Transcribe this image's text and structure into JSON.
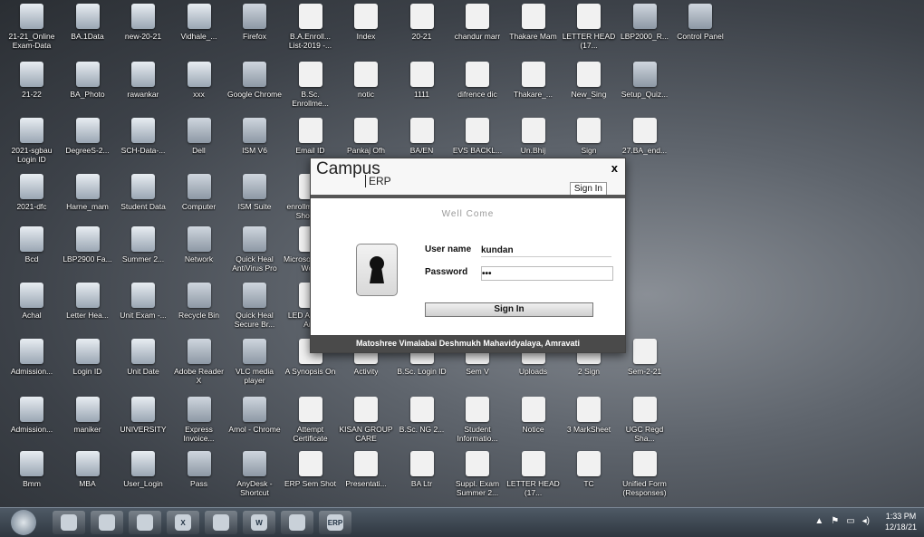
{
  "desktop": {
    "icons": [
      {
        "label": "21-21_Online Exam-Data",
        "kind": "folder"
      },
      {
        "label": "BA.1Data",
        "kind": "folder"
      },
      {
        "label": "new-20-21",
        "kind": "folder"
      },
      {
        "label": "Vidhale_...",
        "kind": "folder"
      },
      {
        "label": "Firefox",
        "kind": "app"
      },
      {
        "label": "B.A.Enroll... List-2019 -...",
        "kind": "doc"
      },
      {
        "label": "Index",
        "kind": "doc"
      },
      {
        "label": "20-21",
        "kind": "doc"
      },
      {
        "label": "chandur marr",
        "kind": "doc"
      },
      {
        "label": "Thakare Mam",
        "kind": "doc"
      },
      {
        "label": "LETTER HEAD (17...",
        "kind": "doc"
      },
      {
        "label": "LBP2000_R...",
        "kind": "app"
      },
      {
        "label": "Control Panel",
        "kind": "app"
      },
      {
        "label": "21-22",
        "kind": "folder"
      },
      {
        "label": "BA_Photo",
        "kind": "folder"
      },
      {
        "label": "rawankar",
        "kind": "folder"
      },
      {
        "label": "xxx",
        "kind": "folder"
      },
      {
        "label": "Google Chrome",
        "kind": "app"
      },
      {
        "label": "B.Sc. Enrollme...",
        "kind": "doc"
      },
      {
        "label": "notic",
        "kind": "doc"
      },
      {
        "label": "1111",
        "kind": "doc"
      },
      {
        "label": "difrence dic",
        "kind": "doc"
      },
      {
        "label": "Thakare_...",
        "kind": "doc"
      },
      {
        "label": "New_Sing",
        "kind": "doc"
      },
      {
        "label": "Setup_Quiz...",
        "kind": "app"
      },
      {
        "label": "2021-sgbau Login ID",
        "kind": "folder"
      },
      {
        "label": "DegreeS-2...",
        "kind": "folder"
      },
      {
        "label": "SCH-Data-...",
        "kind": "folder"
      },
      {
        "label": "Dell",
        "kind": "app"
      },
      {
        "label": "ISM V6",
        "kind": "app"
      },
      {
        "label": "Email ID",
        "kind": "doc"
      },
      {
        "label": "Pankaj Ofh",
        "kind": "doc"
      },
      {
        "label": "BA/EN",
        "kind": "doc"
      },
      {
        "label": "EVS BACKL...",
        "kind": "doc"
      },
      {
        "label": "Un.Bhij",
        "kind": "doc"
      },
      {
        "label": "Sign",
        "kind": "doc"
      },
      {
        "label": "27.BA_end...",
        "kind": "doc"
      },
      {
        "label": "2021-dfc",
        "kind": "folder"
      },
      {
        "label": "Harne_mam",
        "kind": "folder"
      },
      {
        "label": "Student Data",
        "kind": "folder"
      },
      {
        "label": "Computer",
        "kind": "app"
      },
      {
        "label": "ISM Suite",
        "kind": "app"
      },
      {
        "label": "enrollment... - Shortcut",
        "kind": "doc"
      },
      {
        "label": "Bcd",
        "kind": "folder"
      },
      {
        "label": "LBP2900 Fa...",
        "kind": "folder"
      },
      {
        "label": "Summer 2...",
        "kind": "folder"
      },
      {
        "label": "Network",
        "kind": "app"
      },
      {
        "label": "Quick Heal AntiVirus Pro",
        "kind": "app"
      },
      {
        "label": "Microsoft Office Wo...",
        "kind": "doc"
      },
      {
        "label": "Achal",
        "kind": "folder"
      },
      {
        "label": "Letter Hea...",
        "kind": "folder"
      },
      {
        "label": "Unit Exam -...",
        "kind": "folder"
      },
      {
        "label": "Recycle Bin",
        "kind": "app"
      },
      {
        "label": "Quick Heal Secure Br...",
        "kind": "app"
      },
      {
        "label": "LED Ab Data Ans",
        "kind": "doc"
      },
      {
        "label": "Admission...",
        "kind": "folder"
      },
      {
        "label": "Login ID",
        "kind": "folder"
      },
      {
        "label": "Unit Date",
        "kind": "folder"
      },
      {
        "label": "Adobe Reader X",
        "kind": "app"
      },
      {
        "label": "VLC media player",
        "kind": "app"
      },
      {
        "label": "A Synopsis On",
        "kind": "doc"
      },
      {
        "label": "Activity",
        "kind": "doc"
      },
      {
        "label": "B.Sc. Login ID",
        "kind": "doc"
      },
      {
        "label": "Sem V",
        "kind": "doc"
      },
      {
        "label": "Uploads",
        "kind": "doc"
      },
      {
        "label": "2 Sign",
        "kind": "doc"
      },
      {
        "label": "Sem-2-21",
        "kind": "doc"
      },
      {
        "label": "Admission...",
        "kind": "folder"
      },
      {
        "label": "maniker",
        "kind": "folder"
      },
      {
        "label": "UNIVERSITY",
        "kind": "folder"
      },
      {
        "label": "Express Invoice...",
        "kind": "app"
      },
      {
        "label": "Amol - Chrome",
        "kind": "app"
      },
      {
        "label": "Attempt Certificate",
        "kind": "doc"
      },
      {
        "label": "KISAN GROUP CARE",
        "kind": "doc"
      },
      {
        "label": "B.Sc. NG 2...",
        "kind": "doc"
      },
      {
        "label": "Student Informatio...",
        "kind": "doc"
      },
      {
        "label": "Notice",
        "kind": "doc"
      },
      {
        "label": "3 MarkSheet",
        "kind": "doc"
      },
      {
        "label": "UGC Regd Sha...",
        "kind": "doc"
      },
      {
        "label": "Bmm",
        "kind": "folder"
      },
      {
        "label": "MBA",
        "kind": "folder"
      },
      {
        "label": "User_Login",
        "kind": "folder"
      },
      {
        "label": "Pass",
        "kind": "app"
      },
      {
        "label": "AnyDesk - Shortcut",
        "kind": "app"
      },
      {
        "label": "ERP Sem Shot",
        "kind": "doc"
      },
      {
        "label": "Presentati...",
        "kind": "doc"
      },
      {
        "label": "BA Ltr",
        "kind": "doc"
      },
      {
        "label": "Suppl. Exam Summer 2...",
        "kind": "doc"
      },
      {
        "label": "LETTER HEAD (17...",
        "kind": "doc"
      },
      {
        "label": "TC",
        "kind": "doc"
      },
      {
        "label": "Unified Form (Responses)",
        "kind": "doc"
      }
    ]
  },
  "dialog": {
    "brand": "Campus",
    "brand_sub": "ERP",
    "close": "x",
    "signin_link": "Sign In",
    "welcome": "Well Come",
    "username_label": "User name",
    "username_value": "kundan",
    "password_label": "Password",
    "password_value": "•••",
    "signin_button": "Sign In",
    "footer": "Matoshree Vimalabai Deshmukh Mahavidyalaya, Amravati"
  },
  "taskbar": {
    "items": [
      "ie-icon",
      "explorer-icon",
      "media-icon",
      "excel-icon",
      "chrome-icon",
      "word-icon",
      "paint-icon",
      "erp-icon"
    ],
    "item_labels": [
      "",
      "",
      "",
      "X",
      "",
      "W",
      "",
      "ERP"
    ],
    "tray": [
      "▲",
      "⚑",
      "▭",
      "◂)"
    ],
    "time": "1:33 PM",
    "date": "12/18/21"
  }
}
